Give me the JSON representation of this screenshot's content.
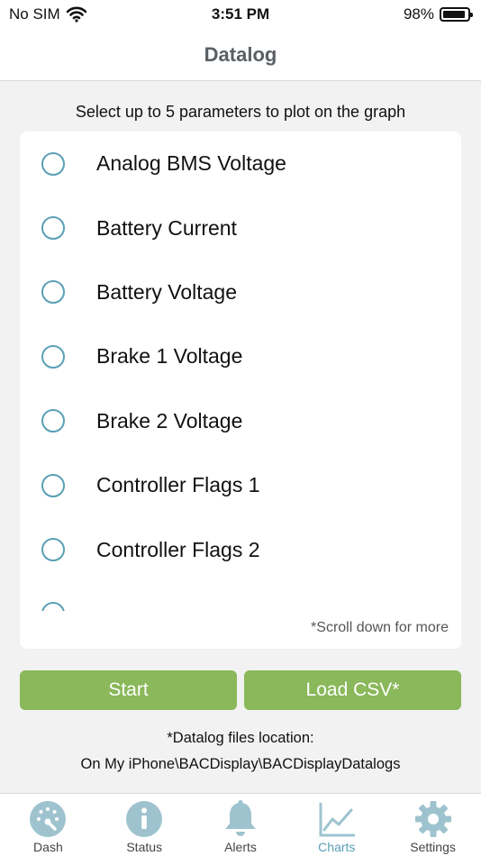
{
  "status_bar": {
    "carrier": "No SIM",
    "time": "3:51 PM",
    "battery": "98%"
  },
  "nav": {
    "title": "Datalog"
  },
  "instructions": "Select up to 5 parameters to plot on the graph",
  "parameters": [
    "Analog BMS Voltage",
    "Battery Current",
    "Battery Voltage",
    "Brake 1 Voltage",
    "Brake 2 Voltage",
    "Controller Flags 1",
    "Controller Flags 2",
    ""
  ],
  "scroll_hint": "*Scroll down for more",
  "buttons": {
    "start": "Start",
    "load_csv": "Load CSV*"
  },
  "location": {
    "title": "*Datalog files location:",
    "path": "On My iPhone\\BACDisplay\\BACDisplayDatalogs"
  },
  "tabs": [
    {
      "label": "Dash",
      "icon": "gauge-icon",
      "active": false
    },
    {
      "label": "Status",
      "icon": "info-icon",
      "active": false
    },
    {
      "label": "Alerts",
      "icon": "bell-icon",
      "active": false
    },
    {
      "label": "Charts",
      "icon": "chart-icon",
      "active": true
    },
    {
      "label": "Settings",
      "icon": "gear-icon",
      "active": false
    }
  ],
  "colors": {
    "accent": "#5aa0b5",
    "button": "#8ab85a",
    "tab_icon": "#9ec3cf"
  }
}
